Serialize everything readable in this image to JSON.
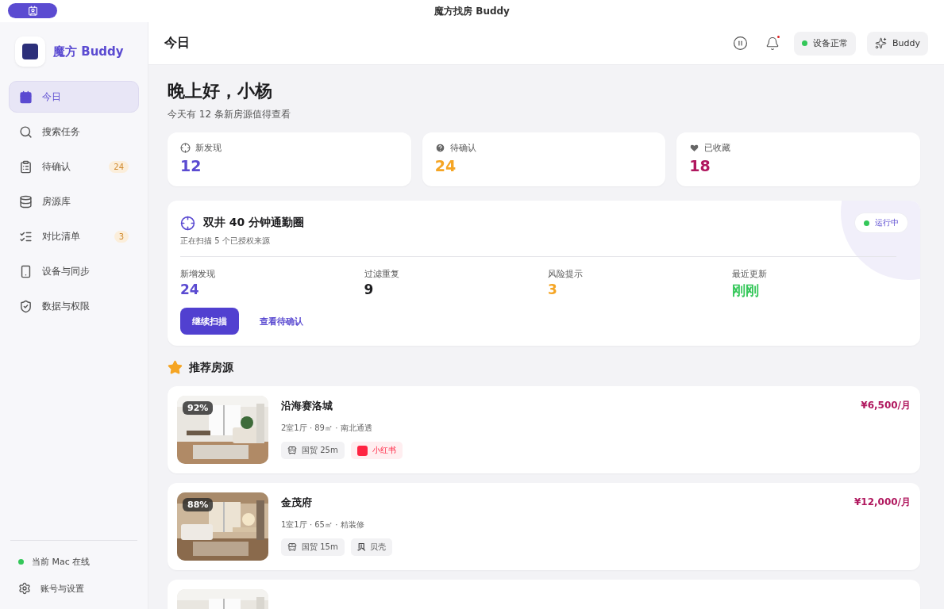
{
  "window": {
    "title": "魔方找房 Buddy"
  },
  "sidebar": {
    "brand": "魔方 Buddy",
    "items": [
      {
        "label": "今日",
        "selected": true
      },
      {
        "label": "搜索任务",
        "selected": false
      },
      {
        "label": "待确认",
        "selected": false,
        "badge": "24"
      },
      {
        "label": "房源库",
        "selected": false
      },
      {
        "label": "对比清单",
        "selected": false,
        "badge": "3"
      },
      {
        "label": "设备与同步",
        "selected": false
      },
      {
        "label": "数据与权限",
        "selected": false
      }
    ],
    "status": {
      "label": "当前 Mac 在线",
      "color": "#34c759"
    },
    "settings": "账号与设置"
  },
  "header": {
    "title": "今日",
    "device_status": {
      "label": "设备正常",
      "color": "#34c759"
    },
    "buddy_button": "Buddy"
  },
  "greeting": {
    "title": "晚上好，小杨",
    "subtitle": "今天有 12 条新房源值得查看"
  },
  "stats": [
    {
      "label": "新发现",
      "value": "12",
      "color": "#5b4bd1"
    },
    {
      "label": "待确认",
      "value": "24",
      "color": "#f5a524"
    },
    {
      "label": "已收藏",
      "value": "18",
      "color": "#b0175e"
    }
  ],
  "task": {
    "title": "双井 40 分钟通勤圈",
    "subtitle": "正在扫描 5 个已授权来源",
    "status": {
      "label": "运行中",
      "color": "#34c759"
    },
    "metrics": [
      {
        "label": "新增发现",
        "value": "24",
        "color": "#5b4bd1"
      },
      {
        "label": "过滤重复",
        "value": "9",
        "color": "#1c1c1e"
      },
      {
        "label": "风险提示",
        "value": "3",
        "color": "#f5a524"
      },
      {
        "label": "最近更新",
        "value": "刚刚",
        "color": "#34c759"
      }
    ],
    "primary_button": "继续扫描",
    "secondary_button": "查看待确认"
  },
  "recommended": {
    "title": "推荐房源",
    "listings": [
      {
        "match": "92%",
        "name": "沿海赛洛城",
        "details": "2室1厅 · 89㎡ · 南北通透",
        "price": "¥6,500/月",
        "tags": [
          {
            "kind": "transit",
            "label": "国贸 25m"
          },
          {
            "kind": "source",
            "label": "小红书",
            "color": "#ff2442"
          }
        ]
      },
      {
        "match": "88%",
        "name": "金茂府",
        "details": "1室1厅 · 65㎡ · 精装修",
        "price": "¥12,000/月",
        "tags": [
          {
            "kind": "transit",
            "label": "国贸 15m"
          },
          {
            "kind": "source",
            "label": "贝壳",
            "mark": "贝",
            "color": "#3a3a3c"
          }
        ]
      },
      {
        "kind": "picture"
      }
    ]
  }
}
